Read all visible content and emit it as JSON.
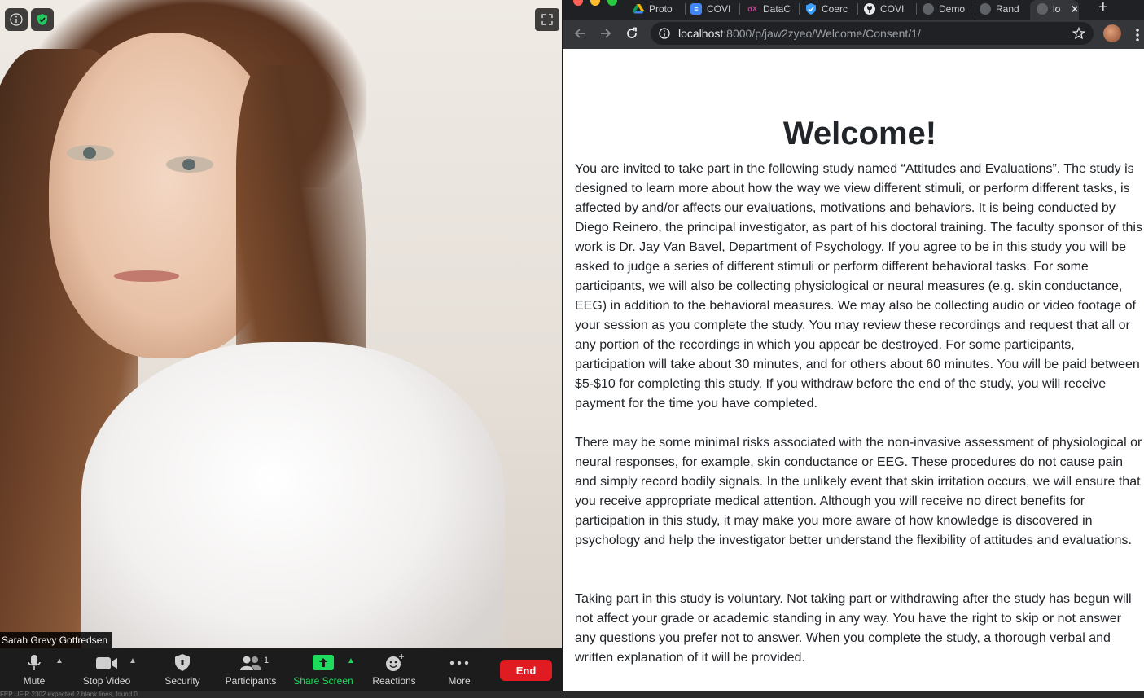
{
  "zoom": {
    "participant_name": "Sarah Grevy Gotfredsen",
    "participants_count": "1",
    "toolbar": {
      "mute": "Mute",
      "stop_video": "Stop Video",
      "security": "Security",
      "participants": "Participants",
      "share_screen": "Share Screen",
      "reactions": "Reactions",
      "more": "More",
      "end": "End"
    },
    "icons": [
      "info-icon",
      "shield-check-icon",
      "fullscreen-icon",
      "microphone-icon",
      "video-camera-icon",
      "shield-icon",
      "people-icon",
      "share-arrow-icon",
      "smiley-plus-icon",
      "ellipsis-icon"
    ],
    "status_strip": "FEP UFIR 2302 expected 2 blank lines, found 0"
  },
  "browser": {
    "tabs": [
      {
        "label": "Proto",
        "icon": "google-drive-icon"
      },
      {
        "label": "COVI",
        "icon": "google-docs-icon"
      },
      {
        "label": "DataC",
        "icon": "edx-icon"
      },
      {
        "label": "Coerc",
        "icon": "shield-icon"
      },
      {
        "label": "COVI",
        "icon": "github-icon"
      },
      {
        "label": "Demo",
        "icon": "globe-icon"
      },
      {
        "label": "Rand",
        "icon": "globe-icon"
      },
      {
        "label": "lo",
        "icon": "globe-icon",
        "active": true
      }
    ],
    "address": {
      "host": "localhost",
      "path": ":8000/p/jaw2zyeo/Welcome/Consent/1/"
    },
    "colors": {
      "tabbar": "#202124",
      "toolbar": "#35363a",
      "close": "#ff5f57",
      "minimize": "#febc2e",
      "maximize": "#28c840"
    }
  },
  "page": {
    "title": "Welcome!",
    "paragraphs": [
      "You are invited to take part in the following study named “Attitudes and Evaluations”. The study is designed to learn more about how the way we view different stimuli, or perform different tasks, is affected by and/or affects our evaluations, motivations and behaviors. It is being conducted by Diego Reinero, the principal investigator, as part of his doctoral training. The faculty sponsor of this work is Dr. Jay Van Bavel, Department of Psychology. If you agree to be in this study you will be asked to judge a series of different stimuli or perform different behavioral tasks. For some participants, we will also be collecting physiological or neural measures (e.g. skin conductance, EEG) in addition to the behavioral measures. We may also be collecting audio or video footage of your session as you complete the study. You may review these recordings and request that all or any portion of the recordings in which you appear be destroyed. For some participants, participation will take about 30 minutes, and for others about 60 minutes. You will be paid between $5-$10 for completing this study. If you withdraw before the end of the study, you will receive payment for the time you have completed.",
      "There may be some minimal risks associated with the non-invasive assessment of physiological or neural responses, for example, skin conductance or EEG. These procedures do not cause pain and simply record bodily signals. In the unlikely event that skin irritation occurs, we will ensure that you receive appropriate medical attention. Although you will receive no direct benefits for participation in this study, it may make you more aware of how knowledge is discovered in psychology and help the investigator better understand the flexibility of attitudes and evaluations.",
      "Taking part in this study is voluntary. Not taking part or withdrawing after the study has begun will not affect your grade or academic standing in any way. You have the right to skip or not answer any questions you prefer not to answer. When you complete the study, a thorough verbal and written explanation of it will be provided."
    ]
  }
}
